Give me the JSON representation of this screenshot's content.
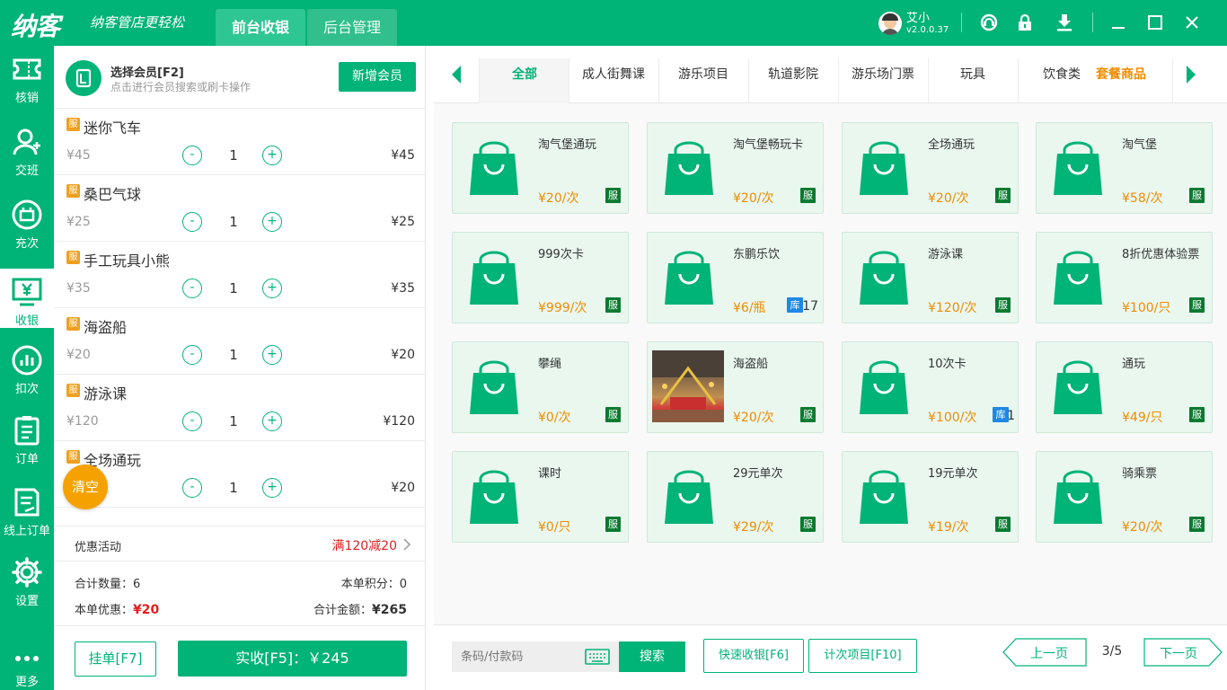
{
  "header": {
    "logo": "纳客",
    "slogan": "纳客管店更轻松",
    "tabs": [
      {
        "label": "前台收银"
      },
      {
        "label": "后台管理"
      }
    ],
    "user_name": "艾小",
    "version": "v2.0.0.37"
  },
  "sidebar": {
    "items": [
      {
        "label": "核销"
      },
      {
        "label": "交班"
      },
      {
        "label": "充次"
      },
      {
        "label": "收银"
      },
      {
        "label": "扣次"
      },
      {
        "label": "订单"
      },
      {
        "label": "线上订单"
      },
      {
        "label": "设置"
      },
      {
        "label": "更多"
      }
    ]
  },
  "member": {
    "title": "选择会员[F2]",
    "subtitle": "点击进行会员搜索或刷卡操作",
    "add_button": "新增会员"
  },
  "cart": {
    "tag": "服",
    "items": [
      {
        "name": "迷你飞车",
        "price": "¥45",
        "qty": "1",
        "total": "¥45"
      },
      {
        "name": "桑巴气球",
        "price": "¥25",
        "qty": "1",
        "total": "¥25"
      },
      {
        "name": "手工玩具小熊",
        "price": "¥35",
        "qty": "1",
        "total": "¥35"
      },
      {
        "name": "海盗船",
        "price": "¥20",
        "qty": "1",
        "total": "¥20"
      },
      {
        "name": "游泳课",
        "price": "¥120",
        "qty": "1",
        "total": "¥120"
      },
      {
        "name": "全场通玩",
        "price": "",
        "qty": "1",
        "total": "¥20"
      }
    ],
    "minus": "-",
    "plus": "+",
    "clear_label": "清空"
  },
  "promo": {
    "label": "优惠活动",
    "value": "满120减20"
  },
  "summary": {
    "count_label": "合计数量：",
    "count": "6",
    "points_label": "本单积分：",
    "points": "0",
    "discount_label": "本单优惠：",
    "discount": "¥20",
    "amount_label": "合计金额：",
    "amount": "¥265"
  },
  "actions": {
    "hold": "挂单[F7]",
    "pay": "实收[F5]：￥245"
  },
  "categories": [
    "全部",
    "成人街舞课",
    "游乐项目",
    "轨道影院",
    "游乐场门票",
    "玩具",
    "饮食类",
    "套餐商品"
  ],
  "products": [
    {
      "name": "淘气堡通玩",
      "price": "¥20/次",
      "tag": "服"
    },
    {
      "name": "淘气堡畅玩卡",
      "price": "¥20/次",
      "tag": "服"
    },
    {
      "name": "全场通玩",
      "price": "¥20/次",
      "tag": "服"
    },
    {
      "name": "淘气堡",
      "price": "¥58/次",
      "tag": "服"
    },
    {
      "name": "999次卡",
      "price": "¥999/次",
      "tag": "服"
    },
    {
      "name": "东鹏乐饮",
      "price": "¥6/瓶",
      "tag": "库",
      "stock": "17"
    },
    {
      "name": "游泳课",
      "price": "¥120/次",
      "tag": "服"
    },
    {
      "name": "8折优惠体验票",
      "price": "¥100/只",
      "tag": "服"
    },
    {
      "name": "攀绳",
      "price": "¥0/次",
      "tag": "服"
    },
    {
      "name": "海盗船",
      "price": "¥20/次",
      "tag": "服",
      "photo": true
    },
    {
      "name": "10次卡",
      "price": "¥100/次",
      "tag": "库",
      "stock": "1"
    },
    {
      "name": "通玩",
      "price": "¥49/只",
      "tag": "服"
    },
    {
      "name": "课时",
      "price": "¥0/只",
      "tag": "服"
    },
    {
      "name": "29元单次",
      "price": "¥29/次",
      "tag": "服"
    },
    {
      "name": "19元单次",
      "price": "¥19/次",
      "tag": "服"
    },
    {
      "name": "骑乘票",
      "price": "¥20/次",
      "tag": "服"
    }
  ],
  "bottom": {
    "search_placeholder": "条码/付款码",
    "search_button": "搜索",
    "quick_pay": "快速收银[F6]",
    "count_items": "计次项目[F10]",
    "prev": "上一页",
    "page": "3/5",
    "next": "下一页"
  },
  "colors": {
    "primary": "#00b377",
    "accent_orange": "#f08c00",
    "discount_red": "#e02020",
    "clear_button": "#f5a200"
  }
}
